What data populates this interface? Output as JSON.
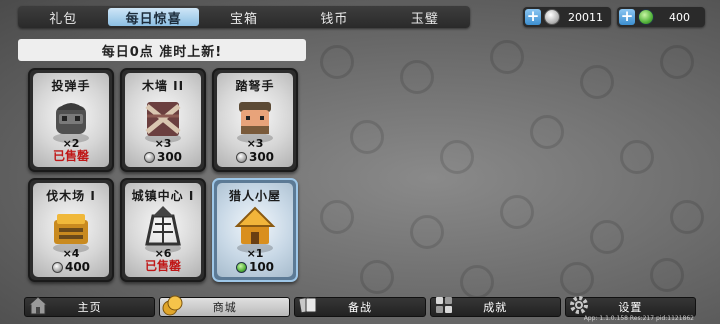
{
  "tabs": [
    {
      "label": "礼包",
      "active": false
    },
    {
      "label": "每日惊喜",
      "active": true
    },
    {
      "label": "宝箱",
      "active": false
    },
    {
      "label": "钱币",
      "active": false
    },
    {
      "label": "玉璧",
      "active": false
    }
  ],
  "currency": {
    "silver": {
      "value": "20011",
      "icon": "silver-coin-icon"
    },
    "gem": {
      "value": "400",
      "icon": "jade-gem-icon"
    }
  },
  "banner": "每日0点 准时上新!",
  "items": [
    {
      "title": "投弹手",
      "qty": "×2",
      "price": "",
      "currency": "silver",
      "status": "已售罄",
      "icon": "bomber-icon"
    },
    {
      "title": "木墙 II",
      "qty": "×3",
      "price": "300",
      "currency": "silver",
      "status": "",
      "icon": "wood-wall-icon"
    },
    {
      "title": "踏弩手",
      "qty": "×3",
      "price": "300",
      "currency": "silver",
      "status": "",
      "icon": "crossbowman-icon"
    },
    {
      "title": "伐木场 I",
      "qty": "×4",
      "price": "400",
      "currency": "silver",
      "status": "",
      "icon": "lumber-mill-icon"
    },
    {
      "title": "城镇中心 I",
      "qty": "×6",
      "price": "",
      "currency": "silver",
      "status": "已售罄",
      "icon": "town-center-icon"
    },
    {
      "title": "猎人小屋",
      "qty": "×1",
      "price": "100",
      "currency": "gem",
      "status": "",
      "icon": "hunter-hut-icon"
    }
  ],
  "nav": [
    {
      "label": "主页",
      "icon": "home-icon",
      "active": false
    },
    {
      "label": "商城",
      "icon": "coins-icon",
      "active": true
    },
    {
      "label": "备战",
      "icon": "cards-icon",
      "active": false
    },
    {
      "label": "成就",
      "icon": "achievements-icon",
      "active": false
    },
    {
      "label": "设置",
      "icon": "gear-icon",
      "active": false
    }
  ],
  "version": "App: 1.1.0.158 Res:217 pid:1121862",
  "colors": {
    "accent_tab": "#8cbfe3",
    "sold_out": "#c01818",
    "selected_card": "#9ec7e8"
  }
}
